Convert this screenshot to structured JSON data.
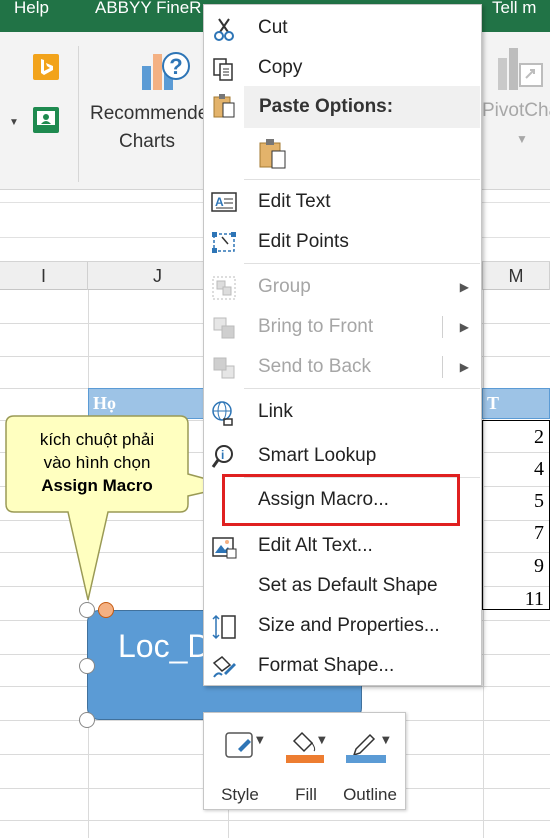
{
  "ribbon": {
    "tabs": [
      "Help",
      "ABBYY FineR",
      "Tell m"
    ],
    "recommended_charts": [
      "Recommended",
      "Charts"
    ],
    "pivot_chart": "PivotCha"
  },
  "columns": [
    "I",
    "J",
    "M"
  ],
  "table": {
    "header_left": "Họ",
    "header_right": "T",
    "values": [
      "2",
      "4",
      "5",
      "7",
      "9",
      "11"
    ]
  },
  "shape": {
    "label": "Loc_D"
  },
  "callout": {
    "line1": "kích chuột phải",
    "line2": "vào hình chọn",
    "line3": "Assign Macro"
  },
  "context_menu": {
    "cut": "Cut",
    "copy": "Copy",
    "paste_options": "Paste Options:",
    "edit_text": "Edit Text",
    "edit_points": "Edit Points",
    "group": "Group",
    "bring_to_front": "Bring to Front",
    "send_to_back": "Send to Back",
    "link": "Link",
    "smart_lookup": "Smart Lookup",
    "assign_macro": "Assign Macro...",
    "edit_alt_text": "Edit Alt Text...",
    "set_default_shape": "Set as Default Shape",
    "size_and_properties": "Size and Properties...",
    "format_shape": "Format Shape..."
  },
  "mini_toolbar": {
    "style": "Style",
    "fill": "Fill",
    "outline": "Outline"
  },
  "colors": {
    "excel_green": "#217346",
    "shape_blue": "#5b9bd5",
    "highlight_red": "#e02020",
    "callout_yellow": "#ffffc0"
  }
}
